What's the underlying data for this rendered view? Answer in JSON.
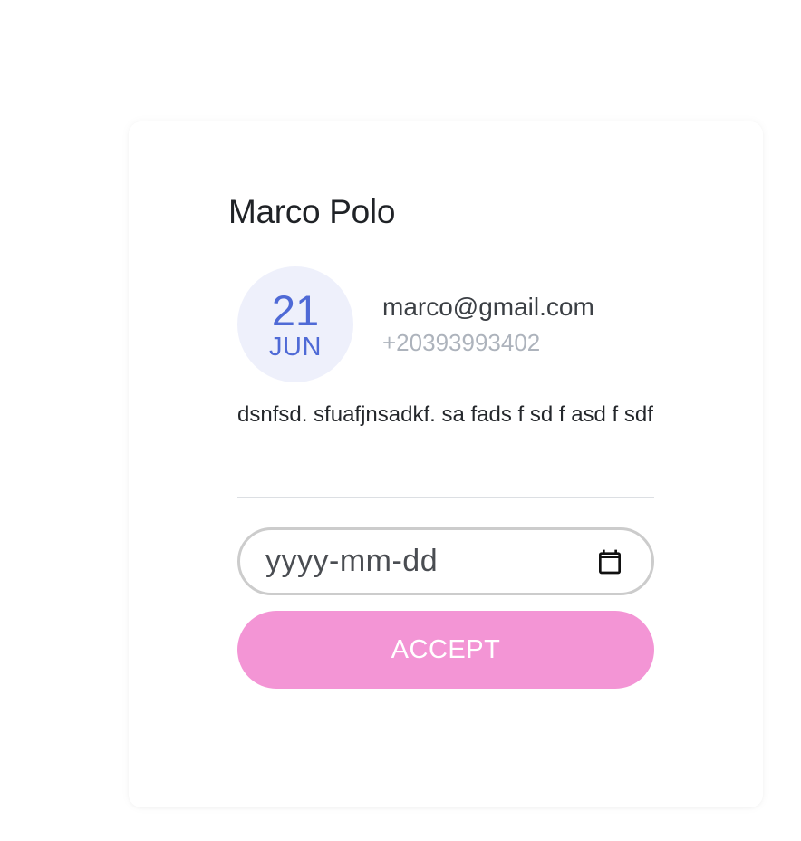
{
  "contact_card": {
    "name": "Marco Polo",
    "date": {
      "day": "21",
      "month": "JUN"
    },
    "email": "marco@gmail.com",
    "phone": "+20393993402",
    "description": "dsnfsd. sfuafjnsadkf. sa fads f sd f asd f sdf",
    "date_input": {
      "placeholder": "yyyy-mm-dd",
      "icon": "calendar-icon"
    },
    "accept_label": "ACCEPT"
  },
  "colors": {
    "accent": "#4f6ad6",
    "badge_background": "#eef0fb",
    "button_background": "#f395d5",
    "muted_text": "#adb3bc"
  }
}
